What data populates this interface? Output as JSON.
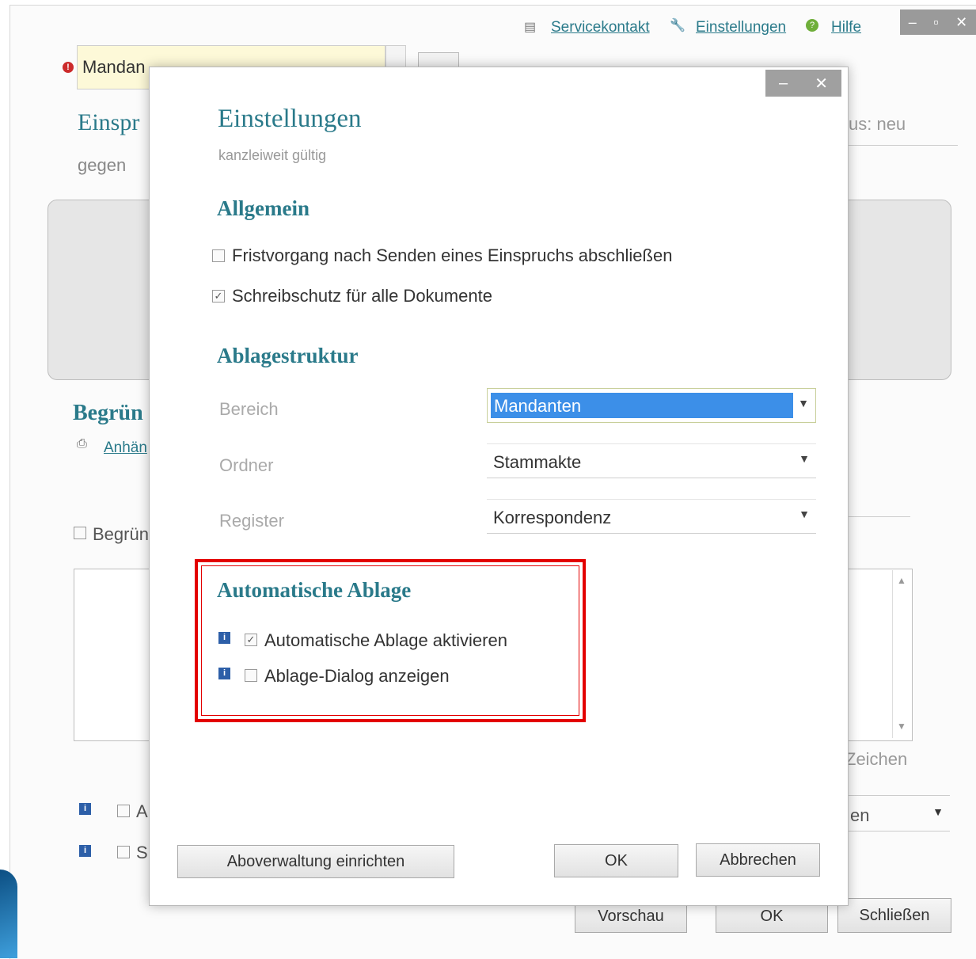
{
  "topbar": {
    "service_label": "Servicekontakt",
    "settings_label": "Einstellungen",
    "help_label": "Hilfe",
    "window_controls": [
      "–",
      "▫",
      "✕"
    ]
  },
  "background": {
    "mandant_value": "Mandan",
    "heading": "Einspr",
    "gegen_label": "gegen",
    "status_text": "us: neu",
    "begruendung_heading": "Begrün",
    "anhaenge_link": "Anhän",
    "begruendung_checkbox_label": "Begrün",
    "zeichen_label": "Zeichen",
    "dropdown_fragment": "en",
    "option_a_fragment": "A",
    "option_s_fragment": "S",
    "preview_button": "Vorschau",
    "ok_button": "OK",
    "close_button": "Schließen"
  },
  "dialog": {
    "title": "Einstellungen",
    "subtitle": "kanzleiweit gültig",
    "window_controls": [
      "–",
      "✕"
    ],
    "general": {
      "heading": "Allgemein",
      "options": [
        {
          "label": "Fristvorgang nach Senden eines Einspruchs abschließen",
          "checked": false
        },
        {
          "label": "Schreibschutz für alle Dokumente",
          "checked": true
        }
      ]
    },
    "filing_structure": {
      "heading": "Ablagestruktur",
      "fields": [
        {
          "label": "Bereich",
          "value": "Mandanten"
        },
        {
          "label": "Ordner",
          "value": "Stammakte"
        },
        {
          "label": "Register",
          "value": "Korrespondenz"
        }
      ]
    },
    "auto_filing": {
      "heading": "Automatische Ablage",
      "options": [
        {
          "label": "Automatische Ablage aktivieren",
          "checked": true
        },
        {
          "label": "Ablage-Dialog anzeigen",
          "checked": false
        }
      ]
    },
    "buttons": {
      "subscription": "Aboverwaltung einrichten",
      "ok": "OK",
      "cancel": "Abbrechen"
    }
  },
  "colors": {
    "accent": "#2a7a8a",
    "selection": "#3c8fe8",
    "highlight_frame": "#e30000",
    "info_icon": "#2d5fa8"
  }
}
